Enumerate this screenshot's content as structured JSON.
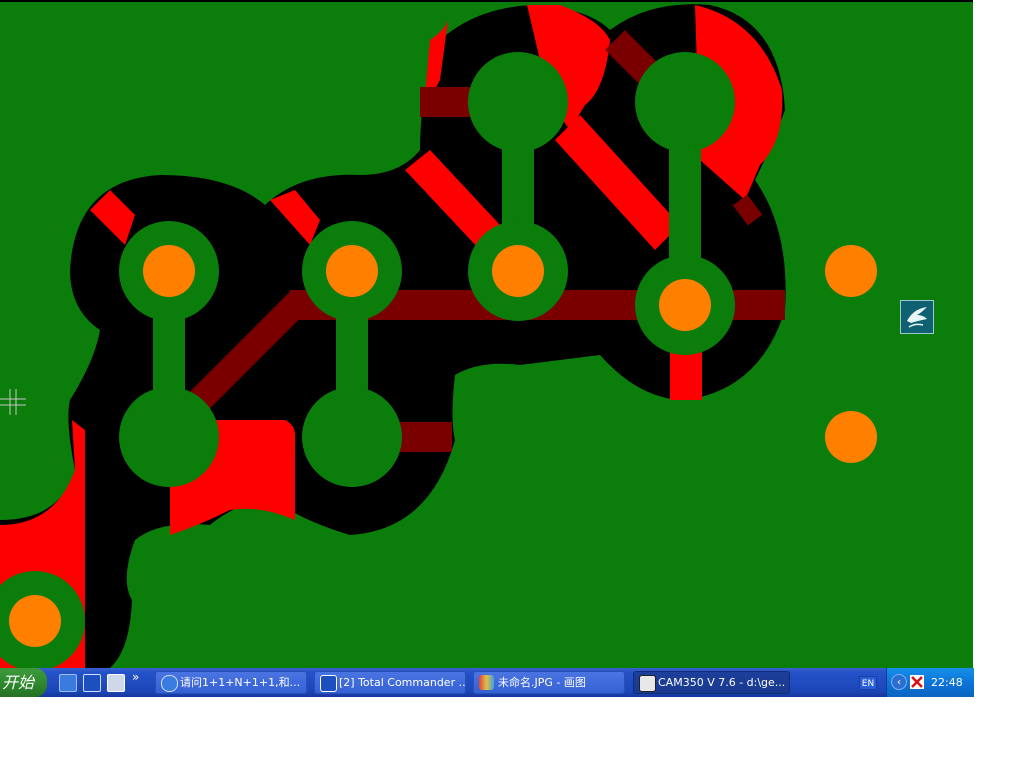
{
  "window": {
    "title": "CAM350 V 7.6 - d:\\ge..."
  },
  "colors": {
    "board": "#0a7d0a",
    "clearance": "#000000",
    "copper_top": "#ff0000",
    "copper_inner": "#7a0000",
    "pad": "#0a7d0a",
    "drill": "#ff7f00"
  },
  "taskbar": {
    "start_label": "开始",
    "quick_launch_more": "»",
    "tasks": [
      {
        "label": "请问1+1+N+1+1,和...",
        "icon": "browser-icon"
      },
      {
        "label": "[2] Total Commander ...",
        "icon": "floppy-icon"
      },
      {
        "label": "未命名.JPG - 画图",
        "icon": "paint-icon"
      },
      {
        "label": "CAM350 V 7.6 - d:\\ge...",
        "icon": "cam350-icon",
        "active": true
      }
    ],
    "language": "EN",
    "clock": "22:48"
  }
}
